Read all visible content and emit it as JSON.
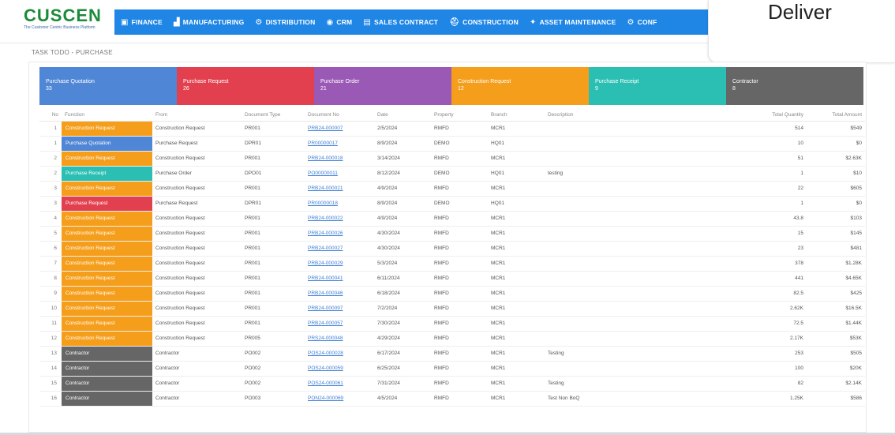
{
  "brand": {
    "name": "CUSCEN",
    "tagline": "The Customer Centric Business Platform",
    "color": "#1b8a3a"
  },
  "nav": {
    "color": "#1f86e6",
    "items": [
      {
        "label": "FINANCE",
        "icon": "finance-icon",
        "glyph": "▣"
      },
      {
        "label": "MANUFACTURING",
        "icon": "manufacturing-icon",
        "glyph": "▟"
      },
      {
        "label": "DISTRIBUTION",
        "icon": "distribution-icon",
        "glyph": "⚙"
      },
      {
        "label": "CRM",
        "icon": "crm-icon",
        "glyph": "◉"
      },
      {
        "label": "SALES CONTRACT",
        "icon": "sales-contract-icon",
        "glyph": "▤"
      },
      {
        "label": "CONSTRUCTION",
        "icon": "construction-icon",
        "glyph": "⛑"
      },
      {
        "label": "ASSET MAINTENANCE",
        "icon": "asset-maintenance-icon",
        "glyph": "✦"
      },
      {
        "label": "CONF",
        "icon": "config-icon",
        "glyph": "⚙"
      }
    ]
  },
  "popup": {
    "text": "Deliver"
  },
  "page": {
    "subtitle": "TASK TODO - PURCHASE"
  },
  "cards": [
    {
      "label": "Purchase Quotation",
      "count": "33",
      "color": "#4f86d6"
    },
    {
      "label": "Purchase Request",
      "count": "26",
      "color": "#e2404e"
    },
    {
      "label": "Purchase Order",
      "count": "21",
      "color": "#9b59b6"
    },
    {
      "label": "Construction Request",
      "count": "12",
      "color": "#f59e1b"
    },
    {
      "label": "Purchase Receipt",
      "count": "9",
      "color": "#2bbfb3"
    },
    {
      "label": "Contractor",
      "count": "8",
      "color": "#666666"
    }
  ],
  "table": {
    "headers": [
      "No",
      "Function",
      "From",
      "Document Type",
      "Document No",
      "Date",
      "Property",
      "Branch",
      "Description",
      "Total Quantity",
      "Total Amount"
    ],
    "rows": [
      {
        "no": "1",
        "func": "Construction Request",
        "color": "#f59e1b",
        "from": "Construction Request",
        "type": "PR001",
        "doc": "PRB24-000007",
        "date": "2/5/2024",
        "property": "RMFD",
        "branch": "MCR1",
        "desc": "",
        "qty": "514",
        "amount": "$549"
      },
      {
        "no": "1",
        "func": "Purchase Quotation",
        "color": "#4f86d6",
        "from": "Purchase Request",
        "type": "DPR01",
        "doc": "PR00000017",
        "date": "8/9/2024",
        "property": "DEMO",
        "branch": "HQ01",
        "desc": "",
        "qty": "10",
        "amount": "$0"
      },
      {
        "no": "2",
        "func": "Construction Request",
        "color": "#f59e1b",
        "from": "Construction Request",
        "type": "PR001",
        "doc": "PRB24-000018",
        "date": "3/14/2024",
        "property": "RMFD",
        "branch": "MCR1",
        "desc": "",
        "qty": "51",
        "amount": "$2.63K"
      },
      {
        "no": "2",
        "func": "Purchase Receipt",
        "color": "#2bbfb3",
        "from": "Purchase Order",
        "type": "DPO01",
        "doc": "PO00000011",
        "date": "8/12/2024",
        "property": "DEMO",
        "branch": "HQ01",
        "desc": "testing",
        "qty": "1",
        "amount": "$10"
      },
      {
        "no": "3",
        "func": "Construction Request",
        "color": "#f59e1b",
        "from": "Construction Request",
        "type": "PR001",
        "doc": "PRB24-000021",
        "date": "4/9/2024",
        "property": "RMFD",
        "branch": "MCR1",
        "desc": "",
        "qty": "22",
        "amount": "$605"
      },
      {
        "no": "3",
        "func": "Purchase Request",
        "color": "#e2404e",
        "from": "Purchase Request",
        "type": "DPR01",
        "doc": "PR00000018",
        "date": "8/9/2024",
        "property": "DEMO",
        "branch": "HQ01",
        "desc": "",
        "qty": "1",
        "amount": "$0"
      },
      {
        "no": "4",
        "func": "Construction Request",
        "color": "#f59e1b",
        "from": "Construction Request",
        "type": "PR001",
        "doc": "PRB24-000022",
        "date": "4/9/2024",
        "property": "RMFD",
        "branch": "MCR1",
        "desc": "",
        "qty": "43.8",
        "amount": "$103"
      },
      {
        "no": "5",
        "func": "Construction Request",
        "color": "#f59e1b",
        "from": "Construction Request",
        "type": "PR001",
        "doc": "PRB24-000026",
        "date": "4/30/2024",
        "property": "RMFD",
        "branch": "MCR1",
        "desc": "",
        "qty": "15",
        "amount": "$145"
      },
      {
        "no": "6",
        "func": "Construction Request",
        "color": "#f59e1b",
        "from": "Construction Request",
        "type": "PR001",
        "doc": "PRB24-000027",
        "date": "4/30/2024",
        "property": "RMFD",
        "branch": "MCR1",
        "desc": "",
        "qty": "23",
        "amount": "$481"
      },
      {
        "no": "7",
        "func": "Construction Request",
        "color": "#f59e1b",
        "from": "Construction Request",
        "type": "PR001",
        "doc": "PRB24-000029",
        "date": "5/3/2024",
        "property": "RMFD",
        "branch": "MCR1",
        "desc": "",
        "qty": "378",
        "amount": "$1.28K"
      },
      {
        "no": "8",
        "func": "Construction Request",
        "color": "#f59e1b",
        "from": "Construction Request",
        "type": "PR001",
        "doc": "PRB24-000041",
        "date": "6/11/2024",
        "property": "RMFD",
        "branch": "MCR1",
        "desc": "",
        "qty": "441",
        "amount": "$4.65K"
      },
      {
        "no": "9",
        "func": "Construction Request",
        "color": "#f59e1b",
        "from": "Construction Request",
        "type": "PR001",
        "doc": "PRB24-000046",
        "date": "6/18/2024",
        "property": "RMFD",
        "branch": "MCR1",
        "desc": "",
        "qty": "82.5",
        "amount": "$425"
      },
      {
        "no": "10",
        "func": "Construction Request",
        "color": "#f59e1b",
        "from": "Construction Request",
        "type": "PR001",
        "doc": "PRB24-000097",
        "date": "7/2/2024",
        "property": "RMFD",
        "branch": "MCR1",
        "desc": "",
        "qty": "2.62K",
        "amount": "$16.5K"
      },
      {
        "no": "11",
        "func": "Construction Request",
        "color": "#f59e1b",
        "from": "Construction Request",
        "type": "PR001",
        "doc": "PRB24-000057",
        "date": "7/30/2024",
        "property": "RMFD",
        "branch": "MCR1",
        "desc": "",
        "qty": "72.5",
        "amount": "$1.44K"
      },
      {
        "no": "12",
        "func": "Construction Request",
        "color": "#f59e1b",
        "from": "Construction Request",
        "type": "PR005",
        "doc": "PRS24-000048",
        "date": "4/29/2024",
        "property": "RMFD",
        "branch": "MCR1",
        "desc": "",
        "qty": "2.17K",
        "amount": "$53K"
      },
      {
        "no": "13",
        "func": "Contractor",
        "color": "#666666",
        "from": "Contractor",
        "type": "PO002",
        "doc": "POS24-000028",
        "date": "6/17/2024",
        "property": "RMFD",
        "branch": "MCR1",
        "desc": "Testing",
        "qty": "253",
        "amount": "$505"
      },
      {
        "no": "14",
        "func": "Contractor",
        "color": "#666666",
        "from": "Contractor",
        "type": "PO002",
        "doc": "POS24-000059",
        "date": "6/25/2024",
        "property": "RMFD",
        "branch": "MCR1",
        "desc": "",
        "qty": "100",
        "amount": "$20K"
      },
      {
        "no": "15",
        "func": "Contractor",
        "color": "#666666",
        "from": "Contractor",
        "type": "PO002",
        "doc": "POS24-000061",
        "date": "7/31/2024",
        "property": "RMFD",
        "branch": "MCR1",
        "desc": "Testing",
        "qty": "82",
        "amount": "$2.14K"
      },
      {
        "no": "16",
        "func": "Contractor",
        "color": "#666666",
        "from": "Contractor",
        "type": "PO003",
        "doc": "PON24-000069",
        "date": "4/5/2024",
        "property": "RMFD",
        "branch": "MCR1",
        "desc": "Test Non BoQ",
        "qty": "1.25K",
        "amount": "$586"
      }
    ]
  }
}
